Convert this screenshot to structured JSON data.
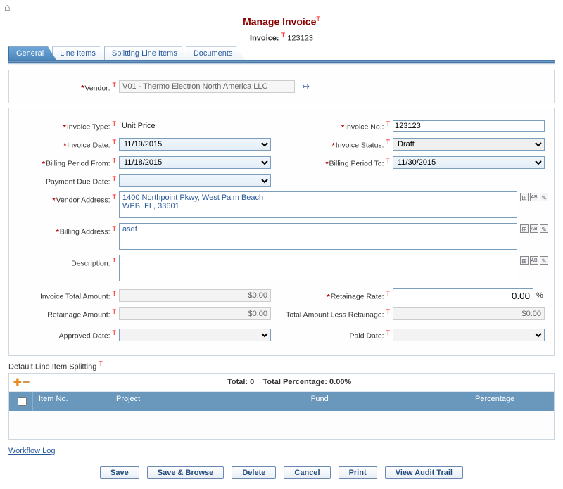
{
  "header": {
    "title": "Manage Invoice",
    "invoice_label": "Invoice:",
    "invoice_no": "123123"
  },
  "tabs": {
    "general": "General",
    "line_items": "Line Items",
    "splitting": "Splitting Line Items",
    "documents": "Documents"
  },
  "vendor": {
    "label": "Vendor:",
    "value": "V01 - Thermo Electron North America LLC"
  },
  "fields": {
    "invoice_type_label": "Invoice Type:",
    "invoice_type_value": "Unit Price",
    "invoice_no_label": "Invoice No.:",
    "invoice_no_value": "123123",
    "invoice_date_label": "Invoice Date:",
    "invoice_date_value": "11/19/2015",
    "invoice_status_label": "Invoice Status:",
    "invoice_status_value": "Draft",
    "billing_from_label": "Billing Period From:",
    "billing_from_value": "11/18/2015",
    "billing_to_label": "Billing Period To:",
    "billing_to_value": "11/30/2015",
    "payment_due_label": "Payment Due Date:",
    "vendor_addr_label": "Vendor Address:",
    "vendor_addr_value": "1400 Northpoint Pkwy, West Palm Beach\nWPB, FL, 33601",
    "billing_addr_label": "Billing Address:",
    "billing_addr_value": "asdf",
    "description_label": "Description:",
    "description_value": "",
    "total_amount_label": "Invoice Total Amount:",
    "total_amount_value": "$0.00",
    "retainage_rate_label": "Retainage Rate:",
    "retainage_rate_value": "0.00",
    "retainage_amount_label": "Retainage Amount:",
    "retainage_amount_value": "$0.00",
    "total_less_label": "Total Amount Less Retainage:",
    "total_less_value": "$0.00",
    "approved_date_label": "Approved Date:",
    "paid_date_label": "Paid Date:"
  },
  "splitting": {
    "section_label": "Default Line Item Splitting",
    "total_label": "Total: 0",
    "pct_label": "Total Percentage: 0.00%",
    "col_item": "Item No.",
    "col_project": "Project",
    "col_fund": "Fund",
    "col_pct": "Percentage"
  },
  "links": {
    "workflow": "Workflow Log"
  },
  "buttons": {
    "save": "Save",
    "save_browse": "Save & Browse",
    "delete": "Delete",
    "cancel": "Cancel",
    "print": "Print",
    "audit": "View Audit Trail"
  }
}
